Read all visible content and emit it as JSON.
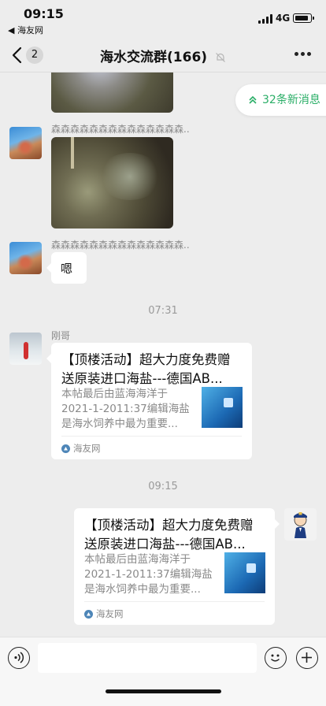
{
  "status_bar": {
    "time": "09:15",
    "back_app": "◀ 海友网",
    "network": "4G"
  },
  "nav": {
    "back_count": "2",
    "title": "海水交流群(166)"
  },
  "new_messages": {
    "label": "32条新消息"
  },
  "messages": [
    {
      "sender_name": "森森森森森森森森森森森森森森..",
      "type": "image"
    },
    {
      "sender_name": "森森森森森森森森森森森森森森..",
      "type": "text",
      "text": "嗯"
    }
  ],
  "timestamps": [
    "07:31",
    "09:15"
  ],
  "link_card_left": {
    "sender_name": "刚哥",
    "title": "【顶楼活动】超大力度免费赠送原装进口海盐---德国AB...",
    "description": "本帖最后由蓝海海洋于2021-1-2011:37编辑海盐是海水饲养中最为重要...",
    "source": "海友网"
  },
  "link_card_right": {
    "title": "【顶楼活动】超大力度免费赠送原装进口海盐---德国AB...",
    "description": "本帖最后由蓝海海洋于2021-1-2011:37编辑海盐是海水饲养中最为重要...",
    "source": "海友网"
  },
  "colors": {
    "accent_green": "#2aae67",
    "background": "#ededed"
  }
}
